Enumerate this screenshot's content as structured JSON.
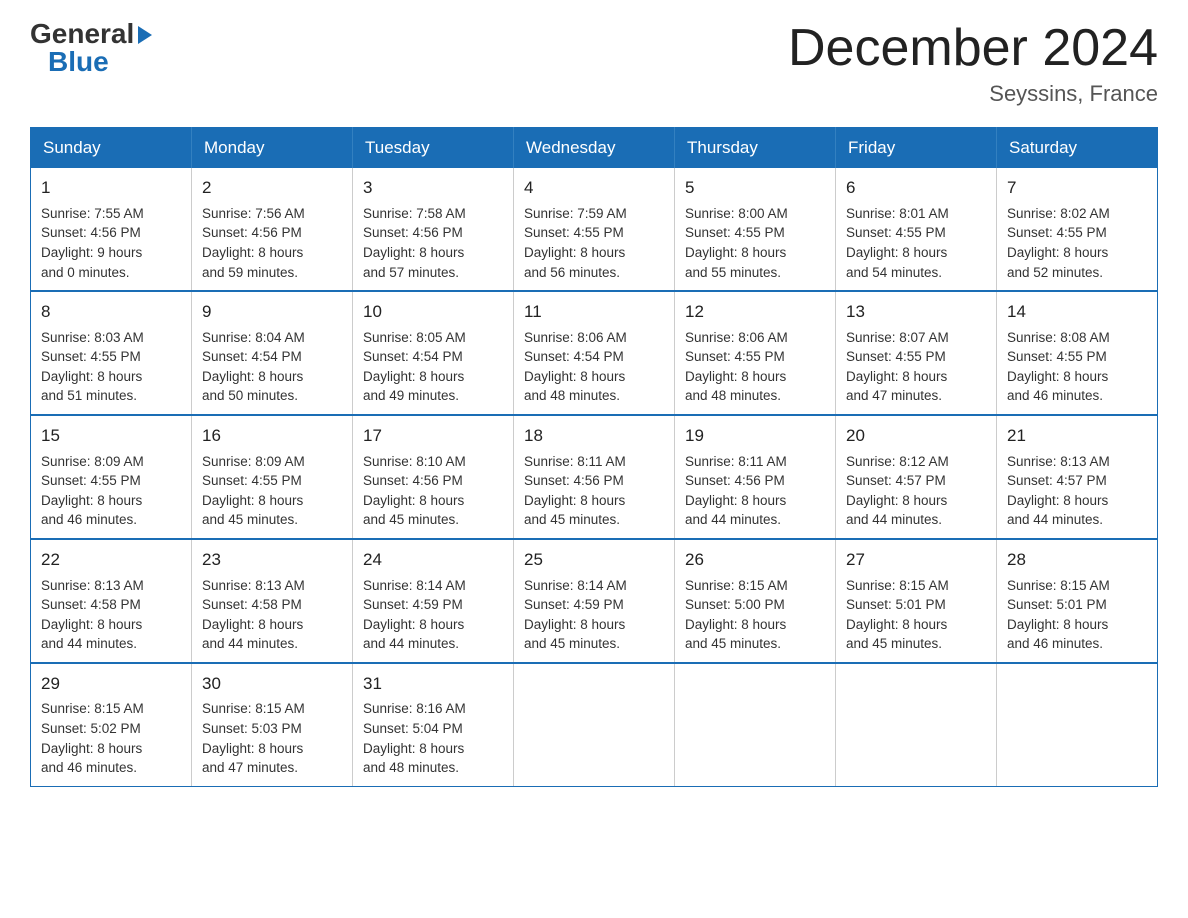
{
  "header": {
    "logo_general": "General",
    "logo_blue": "Blue",
    "month_title": "December 2024",
    "location": "Seyssins, France"
  },
  "weekdays": [
    "Sunday",
    "Monday",
    "Tuesday",
    "Wednesday",
    "Thursday",
    "Friday",
    "Saturday"
  ],
  "weeks": [
    [
      {
        "day": "1",
        "sunrise": "Sunrise: 7:55 AM",
        "sunset": "Sunset: 4:56 PM",
        "daylight": "Daylight: 9 hours",
        "minutes": "and 0 minutes."
      },
      {
        "day": "2",
        "sunrise": "Sunrise: 7:56 AM",
        "sunset": "Sunset: 4:56 PM",
        "daylight": "Daylight: 8 hours",
        "minutes": "and 59 minutes."
      },
      {
        "day": "3",
        "sunrise": "Sunrise: 7:58 AM",
        "sunset": "Sunset: 4:56 PM",
        "daylight": "Daylight: 8 hours",
        "minutes": "and 57 minutes."
      },
      {
        "day": "4",
        "sunrise": "Sunrise: 7:59 AM",
        "sunset": "Sunset: 4:55 PM",
        "daylight": "Daylight: 8 hours",
        "minutes": "and 56 minutes."
      },
      {
        "day": "5",
        "sunrise": "Sunrise: 8:00 AM",
        "sunset": "Sunset: 4:55 PM",
        "daylight": "Daylight: 8 hours",
        "minutes": "and 55 minutes."
      },
      {
        "day": "6",
        "sunrise": "Sunrise: 8:01 AM",
        "sunset": "Sunset: 4:55 PM",
        "daylight": "Daylight: 8 hours",
        "minutes": "and 54 minutes."
      },
      {
        "day": "7",
        "sunrise": "Sunrise: 8:02 AM",
        "sunset": "Sunset: 4:55 PM",
        "daylight": "Daylight: 8 hours",
        "minutes": "and 52 minutes."
      }
    ],
    [
      {
        "day": "8",
        "sunrise": "Sunrise: 8:03 AM",
        "sunset": "Sunset: 4:55 PM",
        "daylight": "Daylight: 8 hours",
        "minutes": "and 51 minutes."
      },
      {
        "day": "9",
        "sunrise": "Sunrise: 8:04 AM",
        "sunset": "Sunset: 4:54 PM",
        "daylight": "Daylight: 8 hours",
        "minutes": "and 50 minutes."
      },
      {
        "day": "10",
        "sunrise": "Sunrise: 8:05 AM",
        "sunset": "Sunset: 4:54 PM",
        "daylight": "Daylight: 8 hours",
        "minutes": "and 49 minutes."
      },
      {
        "day": "11",
        "sunrise": "Sunrise: 8:06 AM",
        "sunset": "Sunset: 4:54 PM",
        "daylight": "Daylight: 8 hours",
        "minutes": "and 48 minutes."
      },
      {
        "day": "12",
        "sunrise": "Sunrise: 8:06 AM",
        "sunset": "Sunset: 4:55 PM",
        "daylight": "Daylight: 8 hours",
        "minutes": "and 48 minutes."
      },
      {
        "day": "13",
        "sunrise": "Sunrise: 8:07 AM",
        "sunset": "Sunset: 4:55 PM",
        "daylight": "Daylight: 8 hours",
        "minutes": "and 47 minutes."
      },
      {
        "day": "14",
        "sunrise": "Sunrise: 8:08 AM",
        "sunset": "Sunset: 4:55 PM",
        "daylight": "Daylight: 8 hours",
        "minutes": "and 46 minutes."
      }
    ],
    [
      {
        "day": "15",
        "sunrise": "Sunrise: 8:09 AM",
        "sunset": "Sunset: 4:55 PM",
        "daylight": "Daylight: 8 hours",
        "minutes": "and 46 minutes."
      },
      {
        "day": "16",
        "sunrise": "Sunrise: 8:09 AM",
        "sunset": "Sunset: 4:55 PM",
        "daylight": "Daylight: 8 hours",
        "minutes": "and 45 minutes."
      },
      {
        "day": "17",
        "sunrise": "Sunrise: 8:10 AM",
        "sunset": "Sunset: 4:56 PM",
        "daylight": "Daylight: 8 hours",
        "minutes": "and 45 minutes."
      },
      {
        "day": "18",
        "sunrise": "Sunrise: 8:11 AM",
        "sunset": "Sunset: 4:56 PM",
        "daylight": "Daylight: 8 hours",
        "minutes": "and 45 minutes."
      },
      {
        "day": "19",
        "sunrise": "Sunrise: 8:11 AM",
        "sunset": "Sunset: 4:56 PM",
        "daylight": "Daylight: 8 hours",
        "minutes": "and 44 minutes."
      },
      {
        "day": "20",
        "sunrise": "Sunrise: 8:12 AM",
        "sunset": "Sunset: 4:57 PM",
        "daylight": "Daylight: 8 hours",
        "minutes": "and 44 minutes."
      },
      {
        "day": "21",
        "sunrise": "Sunrise: 8:13 AM",
        "sunset": "Sunset: 4:57 PM",
        "daylight": "Daylight: 8 hours",
        "minutes": "and 44 minutes."
      }
    ],
    [
      {
        "day": "22",
        "sunrise": "Sunrise: 8:13 AM",
        "sunset": "Sunset: 4:58 PM",
        "daylight": "Daylight: 8 hours",
        "minutes": "and 44 minutes."
      },
      {
        "day": "23",
        "sunrise": "Sunrise: 8:13 AM",
        "sunset": "Sunset: 4:58 PM",
        "daylight": "Daylight: 8 hours",
        "minutes": "and 44 minutes."
      },
      {
        "day": "24",
        "sunrise": "Sunrise: 8:14 AM",
        "sunset": "Sunset: 4:59 PM",
        "daylight": "Daylight: 8 hours",
        "minutes": "and 44 minutes."
      },
      {
        "day": "25",
        "sunrise": "Sunrise: 8:14 AM",
        "sunset": "Sunset: 4:59 PM",
        "daylight": "Daylight: 8 hours",
        "minutes": "and 45 minutes."
      },
      {
        "day": "26",
        "sunrise": "Sunrise: 8:15 AM",
        "sunset": "Sunset: 5:00 PM",
        "daylight": "Daylight: 8 hours",
        "minutes": "and 45 minutes."
      },
      {
        "day": "27",
        "sunrise": "Sunrise: 8:15 AM",
        "sunset": "Sunset: 5:01 PM",
        "daylight": "Daylight: 8 hours",
        "minutes": "and 45 minutes."
      },
      {
        "day": "28",
        "sunrise": "Sunrise: 8:15 AM",
        "sunset": "Sunset: 5:01 PM",
        "daylight": "Daylight: 8 hours",
        "minutes": "and 46 minutes."
      }
    ],
    [
      {
        "day": "29",
        "sunrise": "Sunrise: 8:15 AM",
        "sunset": "Sunset: 5:02 PM",
        "daylight": "Daylight: 8 hours",
        "minutes": "and 46 minutes."
      },
      {
        "day": "30",
        "sunrise": "Sunrise: 8:15 AM",
        "sunset": "Sunset: 5:03 PM",
        "daylight": "Daylight: 8 hours",
        "minutes": "and 47 minutes."
      },
      {
        "day": "31",
        "sunrise": "Sunrise: 8:16 AM",
        "sunset": "Sunset: 5:04 PM",
        "daylight": "Daylight: 8 hours",
        "minutes": "and 48 minutes."
      },
      null,
      null,
      null,
      null
    ]
  ]
}
